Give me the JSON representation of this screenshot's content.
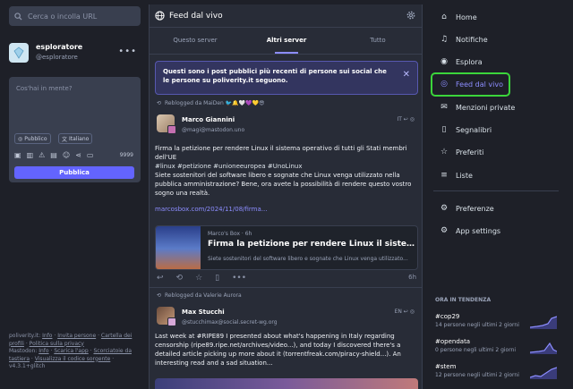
{
  "search": {
    "placeholder": "Cerca o incolla URL"
  },
  "profile": {
    "name": "esploratore",
    "handle": "@esploratore"
  },
  "compose": {
    "placeholder": "Cos'hai in mente?",
    "visibility": "Pubblico",
    "language": "Italiano",
    "counter": "9999",
    "publish": "Pubblica"
  },
  "footer": {
    "line1": "poliverity.it: ",
    "info": "Info",
    "invite": "Invita persone",
    "profiles": "Cartella dei profili",
    "privacy": "Politica sulla privacy",
    "line2": "Mastodon: ",
    "info2": "Info",
    "get_app": "Scarica l'app",
    "shortcuts": "Scorciatoie da tastiera",
    "source": "Visualizza il codice sorgente",
    "version": "v4.3.1+glitch"
  },
  "feed": {
    "title": "Feed dal vivo",
    "tabs": [
      "Questo server",
      "Altri server",
      "Tutto"
    ],
    "notice": "Questi sono i post pubblici più recenti di persone sui social che le persone su poliverity.it seguono."
  },
  "post1": {
    "reblogged_by": "Reblogged da MaiDen 🐦🔔🤍💜💛😎",
    "author": "Marco Giannini",
    "handle": "@magi@mastodon.uno",
    "lang": "IT",
    "text1": "Firma la petizione per rendere Linux il sistema operativo di tutti gli Stati membri dell'UE",
    "text2": "#linux #petizione #unioneeuropea #UnoLinux",
    "text3": "Siete sostenitori del software libero e sognate che Linux venga utilizzato nella pubblica amministrazione? Bene, ora avete la possibilità di rendere questo vostro sogno una realtà.",
    "link": "marcosbox.com/2024/11/08/firma...",
    "card_provider": "Marco's Box · 6h",
    "card_title": "Firma la petizione per rendere Linux il sistema operativo...",
    "card_desc": "Siete sostenitori del software libero e sognate che Linux venga utilizzato...",
    "time": "6h"
  },
  "post2": {
    "reblogged_by": "Reblogged da Valerie Aurora",
    "author": "Max Stucchi",
    "handle": "@stucchimax@social.secret-wg.org",
    "lang": "EN",
    "text1": "Last week at #RIPE89 I presented about what's happening in Italy regarding censorship (ripe89.ripe.net/archives/video...), and today I discovered there's a detailed article picking up more about it (torrentfreak.com/piracy-shield...). An interesting read and a sad situation..."
  },
  "nav": [
    {
      "label": "Home",
      "icon": "home-icon"
    },
    {
      "label": "Notifiche",
      "icon": "bell-icon"
    },
    {
      "label": "Esplora",
      "icon": "compass-icon"
    },
    {
      "label": "Feed dal vivo",
      "icon": "globe-icon"
    },
    {
      "label": "Menzioni private",
      "icon": "mail-icon"
    },
    {
      "label": "Segnalibri",
      "icon": "bookmark-icon"
    },
    {
      "label": "Preferiti",
      "icon": "star-icon"
    },
    {
      "label": "Liste",
      "icon": "list-icon"
    },
    {
      "label": "Preferenze",
      "icon": "gear-icon"
    },
    {
      "label": "App settings",
      "icon": "gears-icon"
    }
  ],
  "trending": {
    "heading": "ORA IN TENDENZA",
    "items": [
      {
        "tag": "#cop29",
        "sub": "14 persone negli ultimi 2 giorni"
      },
      {
        "tag": "#opendata",
        "sub": "0 persone negli ultimi 2 giorni"
      },
      {
        "tag": "#stem",
        "sub": "12 persone negli ultimi 2 giorni"
      }
    ]
  },
  "colors": {
    "accent": "#6364ff",
    "highlight": "#3bd53b",
    "background": "#1e2028",
    "panel": "#282c37"
  }
}
